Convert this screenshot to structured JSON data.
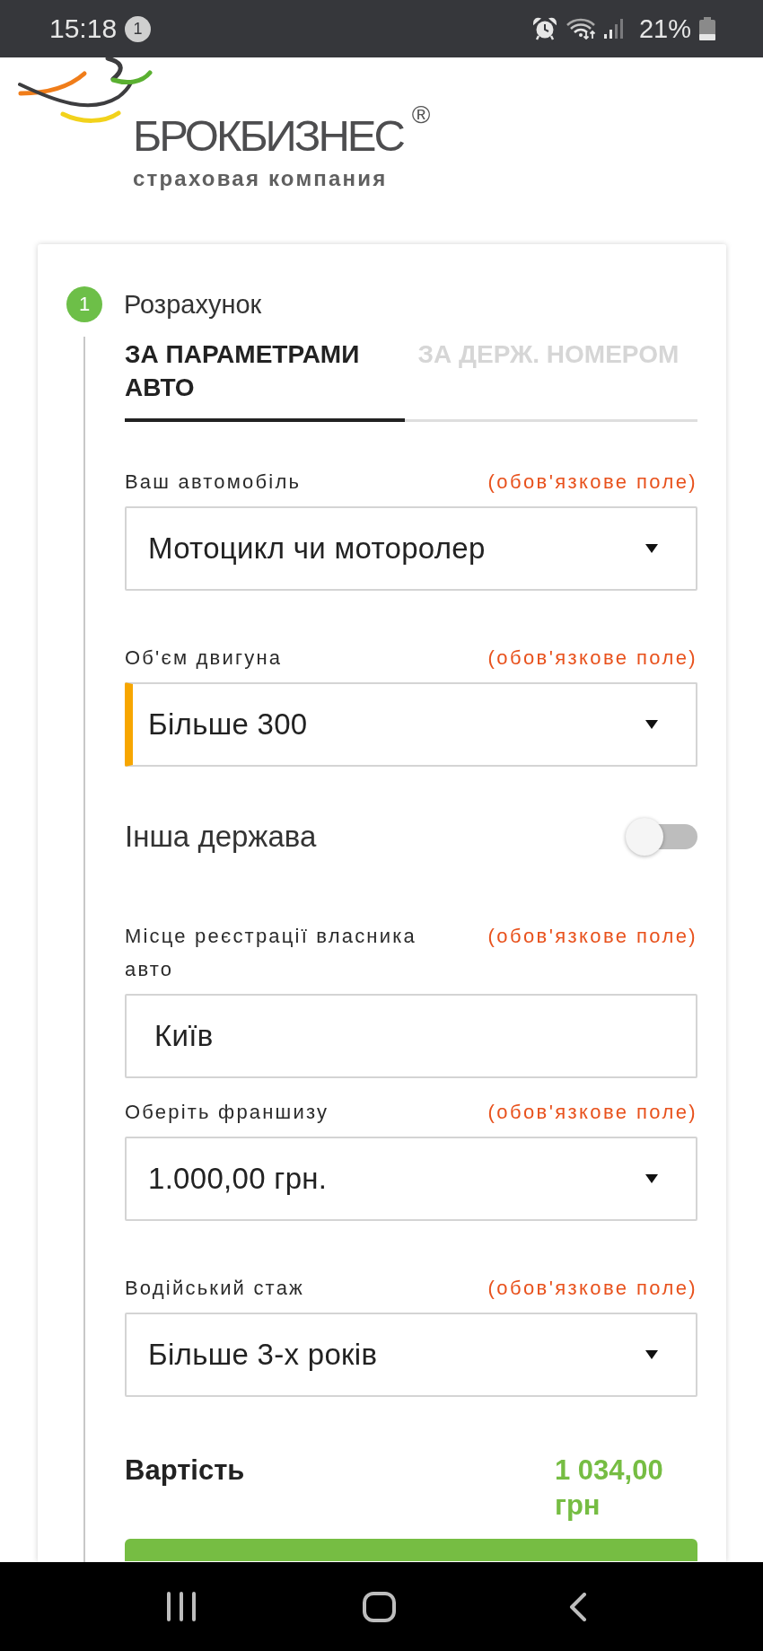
{
  "status_bar": {
    "time": "15:18",
    "notification_count": "1",
    "battery_text": "21%"
  },
  "logo": {
    "brand": "БРОКБИЗНЕС",
    "registered_mark": "®",
    "tagline": "страховая компания"
  },
  "step": {
    "number": "1",
    "title": "Розрахунок"
  },
  "tabs": [
    {
      "label": "ЗА ПАРАМЕТРАМИ АВТО",
      "selected": true
    },
    {
      "label": "ЗА ДЕРЖ. НОМЕРОМ",
      "selected": false
    }
  ],
  "fields": [
    {
      "kind": "select",
      "label": "Ваш автомобіль",
      "required_note": "(обов'язкове поле)",
      "value": "Мотоцикл чи моторолер",
      "highlighted": false
    },
    {
      "kind": "select",
      "label": "Об'єм двигуна",
      "required_note": "(обов'язкове поле)",
      "value": "Більше 300",
      "highlighted": true
    },
    {
      "kind": "toggle",
      "label": "Інша держава",
      "on": false
    },
    {
      "kind": "text",
      "label": "Місце реєстрації власника авто",
      "required_note": "(обов'язкове поле)",
      "value": "Київ",
      "highlighted": false
    },
    {
      "kind": "select",
      "label": "Оберіть франшизу",
      "required_note": "(обов'язкове поле)",
      "value": "1.000,00 грн.",
      "highlighted": false
    },
    {
      "kind": "select",
      "label": "Водійський стаж",
      "required_note": "(обов'язкове поле)",
      "value": "Більше 3-х років",
      "highlighted": false
    }
  ],
  "cost": {
    "label": "Вартість",
    "value": "1 034,00 грн"
  }
}
